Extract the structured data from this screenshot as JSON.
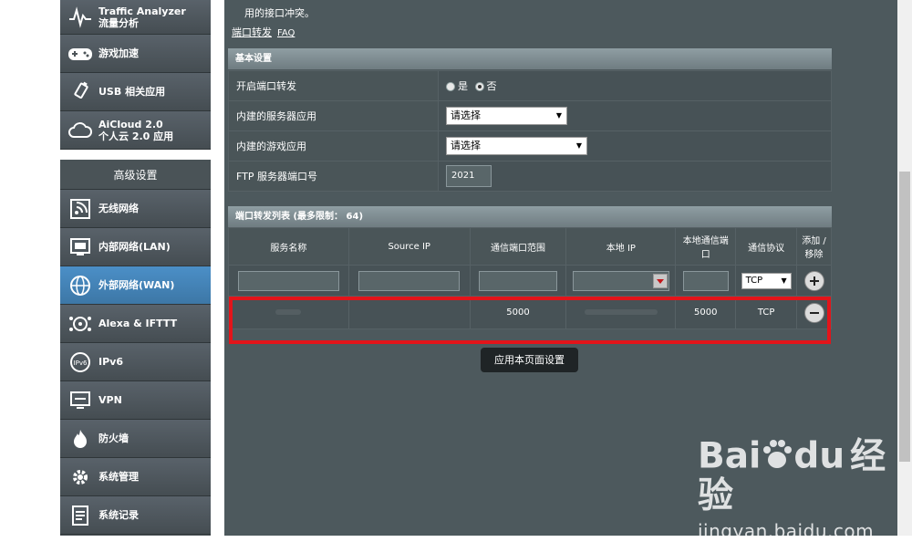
{
  "sidebar": {
    "top_items": [
      {
        "icon": "traffic-analyzer-icon",
        "label_line1": "Traffic Analyzer",
        "label_line2": "流量分析"
      },
      {
        "icon": "gamepad-icon",
        "label_line1": "游戏加速",
        "label_line2": ""
      },
      {
        "icon": "usb-icon",
        "label_line1": "USB 相关应用",
        "label_line2": ""
      },
      {
        "icon": "cloud-icon",
        "label_line1": "AiCloud 2.0",
        "label_line2": "个人云 2.0 应用"
      }
    ],
    "advanced_header": "高级设置",
    "advanced_items": [
      {
        "icon": "wireless-icon",
        "label": "无线网络"
      },
      {
        "icon": "lan-icon",
        "label": "内部网络(LAN)"
      },
      {
        "icon": "globe-icon",
        "label": "外部网络(WAN)"
      },
      {
        "icon": "alexa-ifttt-icon",
        "label": "Alexa & IFTTT"
      },
      {
        "icon": "ipv6-icon",
        "label": "IPv6"
      },
      {
        "icon": "vpn-icon",
        "label": "VPN"
      },
      {
        "icon": "firewall-icon",
        "label": "防火墙"
      },
      {
        "icon": "system-admin-icon",
        "label": "系统管理"
      },
      {
        "icon": "system-log-icon",
        "label": "系统记录"
      }
    ]
  },
  "main": {
    "intro_text": "用的接口冲突。",
    "faq_link": "端口转发",
    "faq_label": "FAQ",
    "basic": {
      "title": "基本设置",
      "enable_label": "开启端口转发",
      "yes_label": "是",
      "no_label": "否",
      "selected": "否",
      "server_app_label": "内建的服务器应用",
      "server_app_value": "请选择",
      "game_app_label": "内建的游戏应用",
      "game_app_value": "请选择",
      "ftp_port_label": "FTP 服务器端口号",
      "ftp_port_value": "2021"
    },
    "list": {
      "title": "端口转发列表 (最多限制： 64)",
      "headers": {
        "service_name": "服务名称",
        "source_ip": "Source IP",
        "port_range": "通信端口范围",
        "local_ip": "本地 IP",
        "local_port": "本地通信端口",
        "protocol": "通信协议",
        "add_remove": "添加 / 移除"
      },
      "new_row": {
        "protocol": "TCP"
      },
      "rules": [
        {
          "service_name": "",
          "source_ip": "",
          "port_range": "5000",
          "local_ip": "",
          "local_port": "5000",
          "protocol": "TCP"
        }
      ]
    },
    "apply_label": "应用本页面设置"
  },
  "watermark": {
    "logo_left": "Bai",
    "logo_right": "du",
    "logo_cn": "经验",
    "url": "jingyan.baidu.com"
  }
}
